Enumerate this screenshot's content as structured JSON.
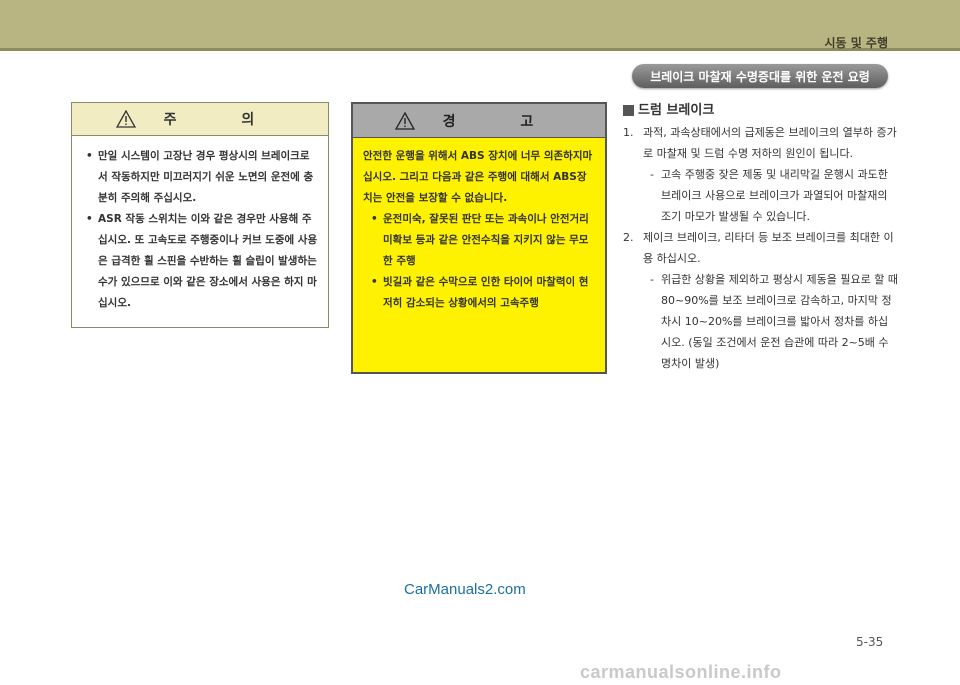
{
  "header": {
    "chapter_title": "시동 및 주행"
  },
  "section": {
    "title": "브레이크 마찰재 수명증대를 위한 운전 요령"
  },
  "caution": {
    "icon": "warning-triangle-icon",
    "title": "주 의",
    "items": [
      "만일 시스템이 고장난 경우 평상시의 브레이크로서 작동하지만 미끄러지기 쉬운 노면의 운전에 충분히 주의해 주십시오.",
      "ASR 작동 스위치는 이와 같은 경우만 사용해 주십시오. 또 고속도로 주행중이나 커브 도중에 사용은 급격한 휠 스핀을 수반하는 휠 슬립이 발생하는 수가 있으므로 이와 같은 장소에서 사용은 하지 마십시오."
    ]
  },
  "warning": {
    "icon": "warning-triangle-icon",
    "title": "경 고",
    "intro": "안전한 운행을 위해서 ABS 장치에 너무 의존하지마십시오. 그리고 다음과 같은 주행에 대해서 ABS장치는 안전을 보장할 수 없습니다.",
    "items": [
      "운전미숙, 잘못된 판단 또는 과속이나 안전거리 미확보 등과 같은 안전수칙을 지키지 않는 무모한 주행",
      "빗길과 같은 수막으로 인한 타이어 마찰력이 현저히 감소되는 상황에서의 고속주행"
    ]
  },
  "drum_brake": {
    "heading": "드럼 브레이크",
    "items": [
      {
        "num": "1.",
        "text": "과적, 과속상태에서의 급제동은 브레이크의 열부하 증가로 마찰재 및 드럼 수명 저하의 원인이 됩니다.",
        "sub": "고속 주행중 잦은 제동 및 내리막길 운행시 과도한 브레이크 사용으로 브레이크가 과열되어 마찰재의 조기 마모가 발생될 수 있습니다."
      },
      {
        "num": "2.",
        "text": "제이크 브레이크, 리타더 등 보조 브레이크를 최대한 이용 하십시오.",
        "sub": "위급한 상황을 제외하고 평상시 제동을 필요로 할 때 80~90%를 보조 브레이크로 감속하고, 마지막 정차시 10~20%를 브레이크를 밟아서 정차를 하십시오. (동일 조건에서 운전 습관에 따라 2~5배 수명차이 발생)"
      }
    ]
  },
  "footer": {
    "site": "CarManuals2.com",
    "page": "5-35",
    "watermark": "carmanualsonline.info"
  },
  "colors": {
    "top_band": "#b9b582",
    "warning_bg": "#fff200",
    "caution_header": "#f2ecc2"
  }
}
